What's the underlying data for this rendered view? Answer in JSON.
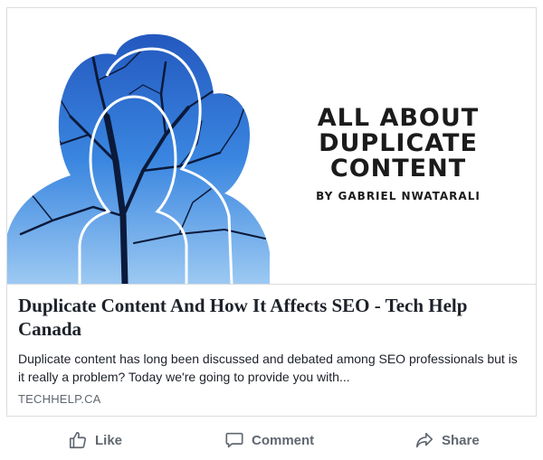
{
  "post": {
    "image": {
      "headline": "ALL ABOUT\nDUPLICATE\nCONTENT",
      "byline": "BY GABRIEL NWATARALI"
    },
    "title": "Duplicate Content And How It Affects SEO - Tech Help Canada",
    "description": "Duplicate content has long been discussed and debated among SEO professionals but is it really a problem? Today we're going to provide you with...",
    "domain": "TECHHELP.CA"
  },
  "actions": {
    "like": {
      "label": "Like",
      "icon": "thumbs-up-icon"
    },
    "comment": {
      "label": "Comment",
      "icon": "comment-icon"
    },
    "share": {
      "label": "Share",
      "icon": "share-arrow-icon"
    }
  },
  "colors": {
    "text_primary": "#1d2129",
    "text_secondary": "#606770",
    "border": "#dadde1",
    "image_blue": "#2b6fd1"
  }
}
